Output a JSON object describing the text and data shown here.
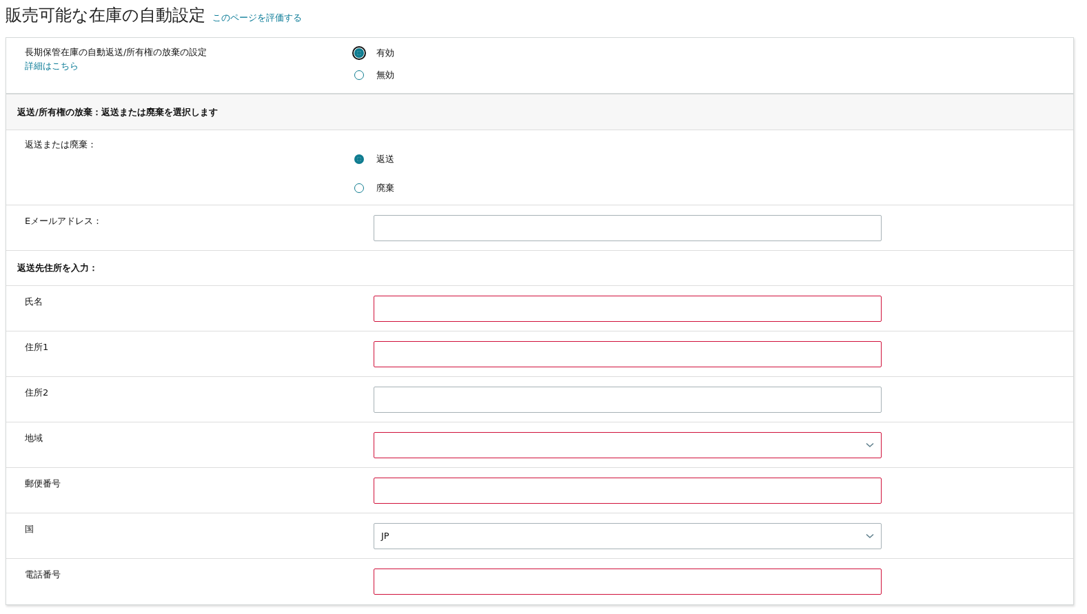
{
  "header": {
    "title": "販売可能な在庫の自動設定",
    "rate_link": "このページを評価する"
  },
  "setting": {
    "label": "長期保管在庫の自動返送/所有権の放棄の設定",
    "link": "詳細はこちら",
    "options": [
      {
        "label": "有効",
        "selected": true
      },
      {
        "label": "無効",
        "selected": false
      }
    ]
  },
  "section_heading": "返送/所有権の放棄：返送または廃棄を選択します",
  "disposition": {
    "label": "返送または廃棄：",
    "options": [
      {
        "label": "返送",
        "selected": true
      },
      {
        "label": "廃棄",
        "selected": false
      }
    ]
  },
  "email": {
    "label": "Eメールアドレス：",
    "required": false
  },
  "address_heading": "返送先住所を入力：",
  "address_fields": [
    {
      "label": "氏名",
      "kind": "text",
      "required": true
    },
    {
      "label": "住所1",
      "kind": "text",
      "required": true
    },
    {
      "label": "住所2",
      "kind": "text",
      "required": false
    },
    {
      "label": "地域",
      "kind": "select",
      "required": true
    },
    {
      "label": "郵便番号",
      "kind": "text",
      "required": true
    },
    {
      "label": "国",
      "kind": "select",
      "required": false,
      "value": "JP"
    },
    {
      "label": "電話番号",
      "kind": "text",
      "required": true
    }
  ]
}
